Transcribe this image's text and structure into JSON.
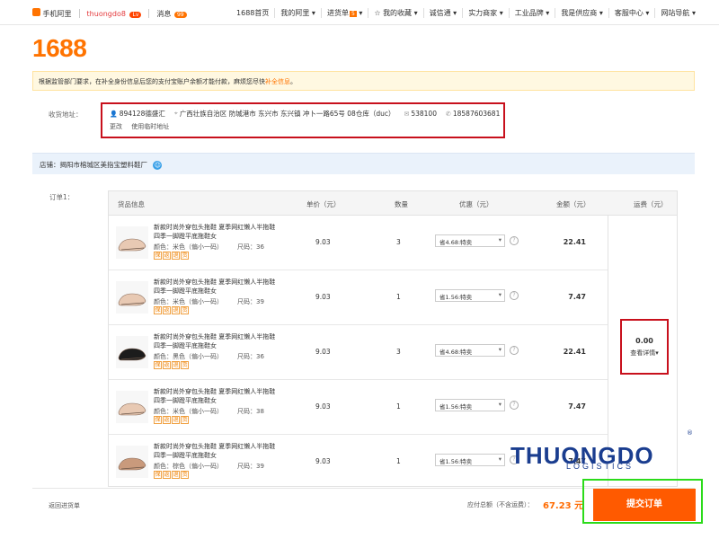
{
  "topnav": {
    "home_label": "手机阿里",
    "user_name": "thuongdo8",
    "user_badge": "Lv",
    "messages_label": "消息",
    "messages_count": "99",
    "links": [
      "1688首页",
      "我的阿里",
      "进货单",
      "我的收藏",
      "诚信通",
      "实力商家",
      "工业品牌",
      "我是供应商",
      "客服中心",
      "网站导航"
    ],
    "cart_count": "5"
  },
  "brand": "1688",
  "notice": {
    "text": "根据监管部门要求，在补全身份信息后您的支付宝账户余额才能付款，麻烦您尽快",
    "link": "补全信息",
    "suffix": "。"
  },
  "address": {
    "label": "收货地址：",
    "name": "894128德盛汇",
    "region": "广西壮族自治区 防城港市 东兴市 东兴镇 冲卜一路65号 08仓库（duc）",
    "zip": "538100",
    "phone": "18587603681",
    "edit_label": "更改",
    "temp_label": "使用临时地址"
  },
  "shop": {
    "label": "店铺：揭阳市榕城区美指宝塑料鞋厂"
  },
  "order": {
    "label": "订单1：",
    "headers": {
      "product": "货品信息",
      "price": "单价（元）",
      "qty": "数量",
      "discount": "优惠（元）",
      "amount": "金额（元）",
      "shipping": "运费（元）"
    },
    "shipping_value": "0.00",
    "shipping_detail": "查看详情",
    "items": [
      {
        "title": "新款时尚外穿包头拖鞋 夏季网红懒人半拖鞋 四季一脚蹬平底拖鞋女",
        "color": "颜色：米色（偏小一码）",
        "size": "尺码：36",
        "price": "9.03",
        "qty": "3",
        "discount": "省4.68:特卖",
        "amount": "22.41",
        "shoe_color": "#e8c9b3"
      },
      {
        "title": "新款时尚外穿包头拖鞋 夏季网红懒人半拖鞋 四季一脚蹬平底拖鞋女",
        "color": "颜色：米色（偏小一码）",
        "size": "尺码：39",
        "price": "9.03",
        "qty": "1",
        "discount": "省1.56:特卖",
        "amount": "7.47",
        "shoe_color": "#e8c9b3"
      },
      {
        "title": "新款时尚外穿包头拖鞋 夏季网红懒人半拖鞋 四季一脚蹬平底拖鞋女",
        "color": "颜色：黑色（偏小一码）",
        "size": "尺码：36",
        "price": "9.03",
        "qty": "3",
        "discount": "省4.68:特卖",
        "amount": "22.41",
        "shoe_color": "#1c1c1c"
      },
      {
        "title": "新款时尚外穿包头拖鞋 夏季网红懒人半拖鞋 四季一脚蹬平底拖鞋女",
        "color": "颜色：米色（偏小一码）",
        "size": "尺码：38",
        "price": "9.03",
        "qty": "1",
        "discount": "省1.56:特卖",
        "amount": "7.47",
        "shoe_color": "#e8c9b3"
      },
      {
        "title": "新款时尚外穿包头拖鞋 夏季网红懒人半拖鞋 四季一脚蹬平底拖鞋女",
        "color": "颜色：棕色（偏小一码）",
        "size": "尺码：39",
        "price": "9.03",
        "qty": "1",
        "discount": "省1.56:特卖",
        "amount": "7.47",
        "shoe_color": "#c99a7c"
      }
    ]
  },
  "bottom": {
    "back_label": "返回进货单",
    "total_label": "应付总额（不含运费）：",
    "total_value": "67.23 元",
    "submit_label": "提交订单"
  },
  "watermark": {
    "text1": "THUONGDO",
    "text2": "LOGISTICS",
    "reg": "®"
  }
}
